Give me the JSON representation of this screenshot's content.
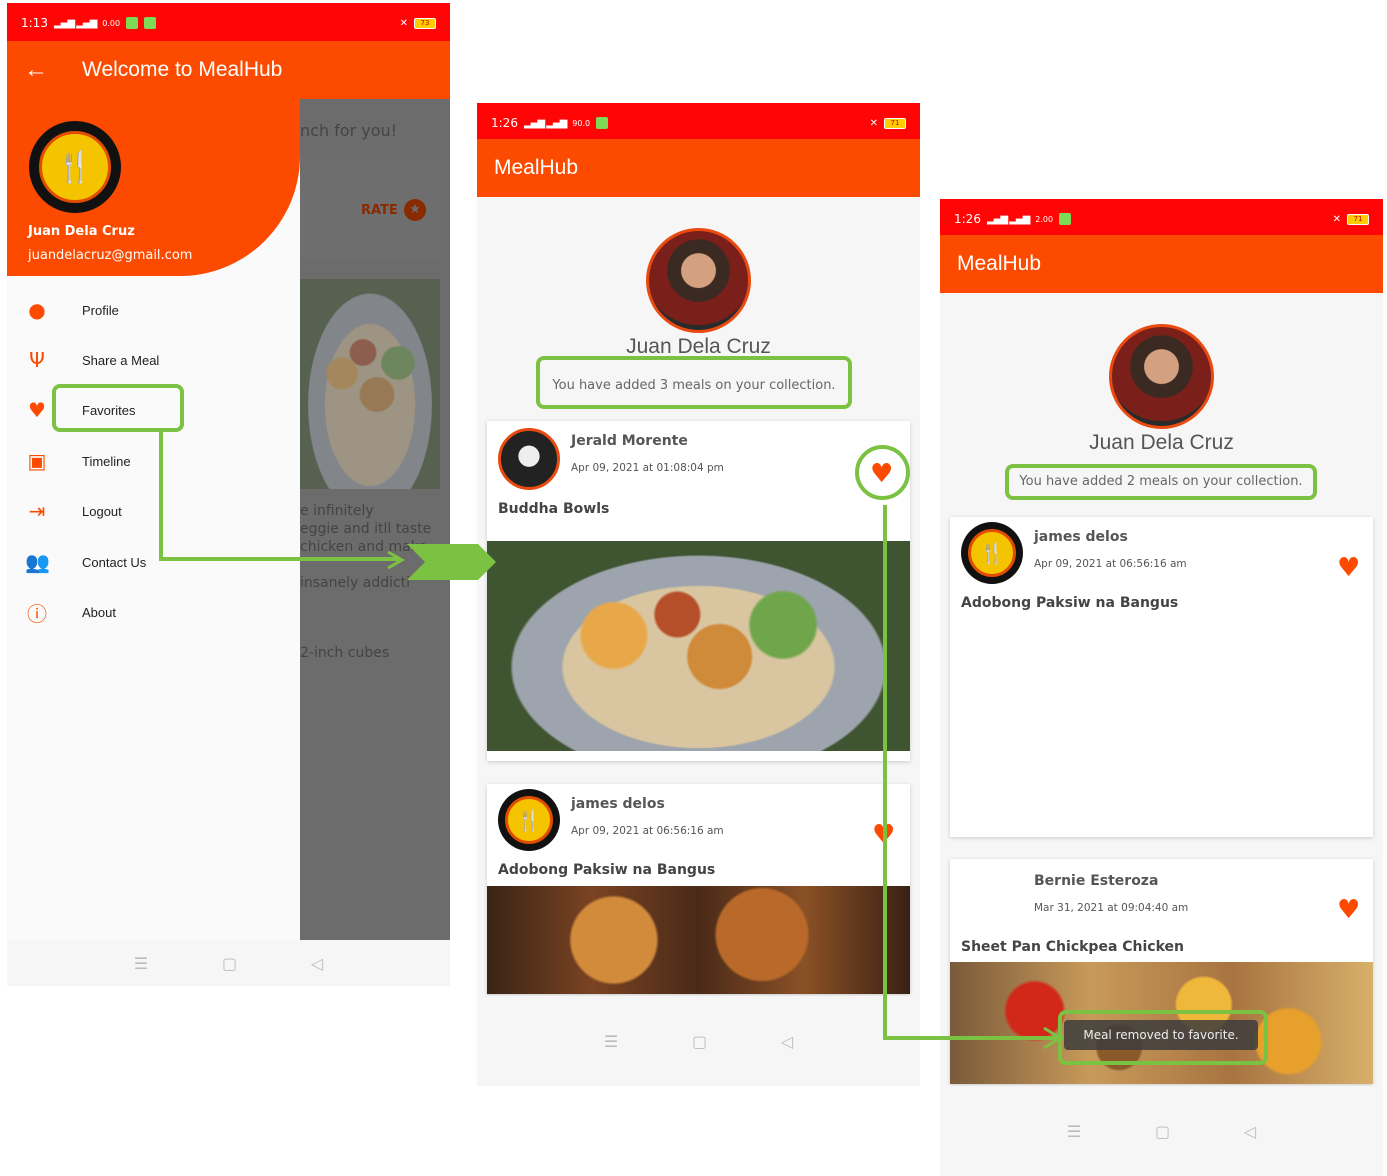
{
  "colors": {
    "accent": "#fc4b00",
    "highlight": "#7cc242"
  },
  "screen1": {
    "status_time": "1:13",
    "status_speed": "0.00",
    "battery": "73",
    "title": "Welcome to MealHub",
    "user_name": "Juan Dela Cruz",
    "user_email": "juandelacruz@gmail.com",
    "menu": [
      {
        "label": "Profile",
        "icon": "person-icon"
      },
      {
        "label": "Share a Meal",
        "icon": "utensils-icon"
      },
      {
        "label": "Favorites",
        "icon": "heart-icon"
      },
      {
        "label": "Timeline",
        "icon": "badge-icon"
      },
      {
        "label": "Logout",
        "icon": "logout-icon"
      },
      {
        "label": "Contact Us",
        "icon": "group-icon"
      },
      {
        "label": "About",
        "icon": "info-icon"
      }
    ],
    "background_texts": {
      "lunch": "nch for you!",
      "rate": "RATE",
      "desc1": "e infinitely",
      "desc2": "eggie and itll taste",
      "desc3": "chicken and make",
      "desc4": "insanely addicti",
      "cubes": "2-inch cubes"
    }
  },
  "screen2": {
    "status_time": "1:26",
    "status_speed": "90.0",
    "battery": "71",
    "title": "MealHub",
    "profile_name": "Juan Dela Cruz",
    "collection_text": "You have added 3 meals on your collection.",
    "cards": [
      {
        "author": "Jerald Morente",
        "date": "Apr 09, 2021 at 01:08:04 pm",
        "title": "Buddha Bowls"
      },
      {
        "author": "james delos",
        "date": "Apr 09, 2021 at 06:56:16 am",
        "title": "Adobong Paksiw na Bangus"
      }
    ]
  },
  "screen3": {
    "status_time": "1:26",
    "status_speed": "2.00",
    "battery": "71",
    "title": "MealHub",
    "profile_name": "Juan Dela Cruz",
    "collection_text": "You have added 2 meals on your collection.",
    "cards": [
      {
        "author": "james delos",
        "date": "Apr 09, 2021 at 06:56:16 am",
        "title": "Adobong Paksiw na Bangus"
      },
      {
        "author": "Bernie Esteroza",
        "date": "Mar 31, 2021 at 09:04:40 am",
        "title": "Sheet Pan Chickpea Chicken"
      }
    ],
    "toast": "Meal removed to favorite."
  }
}
